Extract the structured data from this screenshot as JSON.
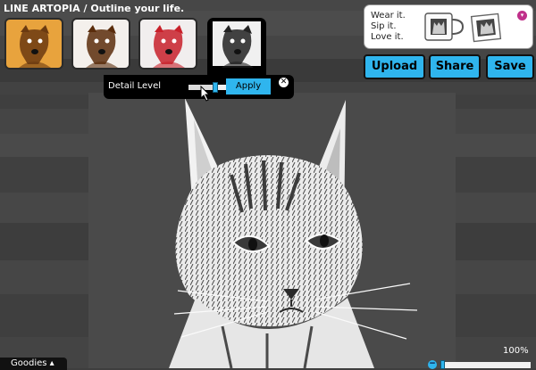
{
  "app": {
    "title": "LINE ARTOPIA / Outline your life."
  },
  "filters": [
    {
      "name": "thumb-sepia-dog",
      "tone": "#e8a33d",
      "ink": "#6b3a10",
      "active": false
    },
    {
      "name": "thumb-brown-dog",
      "tone": "#f4f0ec",
      "ink": "#5a2d0c",
      "active": false
    },
    {
      "name": "thumb-red-dog",
      "tone": "#f1eeee",
      "ink": "#c8202a",
      "active": false
    },
    {
      "name": "thumb-bw-dog",
      "tone": "#eeeeee",
      "ink": "#222222",
      "active": true
    }
  ],
  "promo": {
    "lines": [
      "Wear it.",
      "Sip it.",
      "Love it."
    ],
    "caret": "▾"
  },
  "toolbar": {
    "upload": "Upload",
    "share": "Share",
    "save": "Save"
  },
  "detail": {
    "label": "Detail Level",
    "apply": "Apply",
    "close": "✕",
    "level": 0.72
  },
  "zoom": {
    "label": "100%",
    "minus": "−",
    "level": 0.0
  },
  "goodies": {
    "label": "Goodies ▴"
  },
  "colors": {
    "accent": "#2fb5ee",
    "panel": "#000000",
    "promo_caret": "#c0308a"
  }
}
